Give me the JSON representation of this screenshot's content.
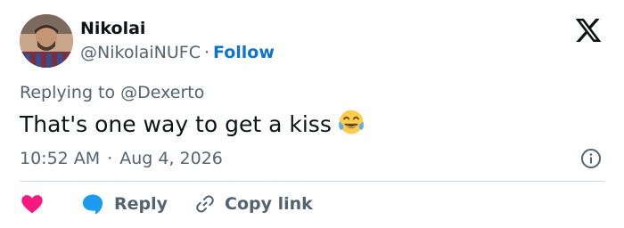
{
  "author": {
    "name": "Nikolai",
    "handle": "@NikolaiNUFC",
    "separator": "·",
    "follow_label": "Follow"
  },
  "brand_logo": "x-logo-icon",
  "reply_context": "Replying to @Dexerto",
  "tweet": {
    "text": "That's one way to get a kiss",
    "emoji": "face-with-tears-of-joy"
  },
  "meta": {
    "time": "10:52 AM",
    "separator": "·",
    "date": "Aug 4, 2026"
  },
  "actions": {
    "like_icon": "heart-icon",
    "reply_label": "Reply",
    "reply_icon": "speech-bubble-icon",
    "copy_link_label": "Copy link",
    "copy_link_icon": "link-icon"
  },
  "colors": {
    "follow": "#0f73c9",
    "heart": "#f91880",
    "reply_bubble": "#1d9bf0",
    "muted_text": "#536471",
    "divider": "#cfd9de"
  }
}
